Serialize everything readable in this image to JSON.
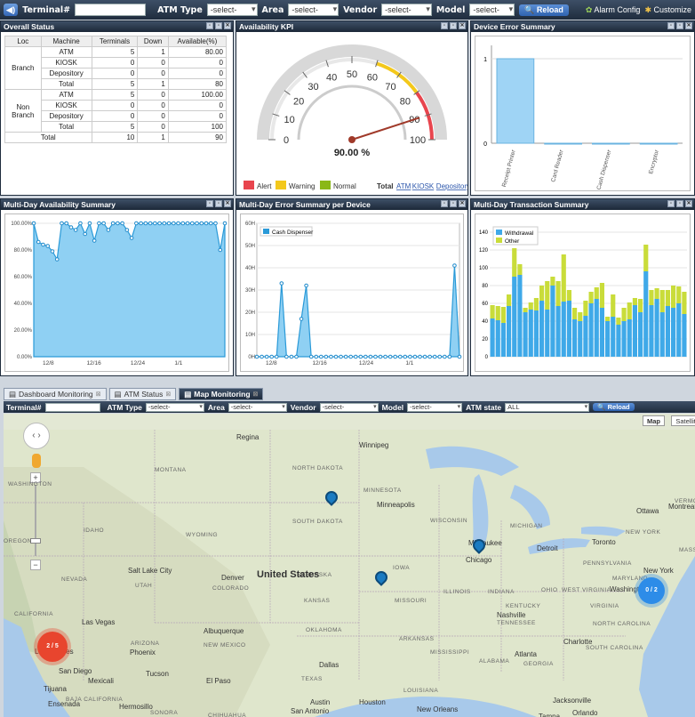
{
  "toolbar": {
    "terminal_label": "Terminal#",
    "atm_type_label": "ATM Type",
    "atm_type_value": "-select-",
    "area_label": "Area",
    "area_value": "-select-",
    "vendor_label": "Vendor",
    "vendor_value": "-select-",
    "model_label": "Model",
    "model_value": "-select-",
    "reload": "Reload",
    "alarm_config": "Alarm Config",
    "customize": "Customize"
  },
  "overall": {
    "title": "Overall Status",
    "headers": [
      "Loc",
      "Machine",
      "Terminals",
      "Down",
      "Available(%)"
    ],
    "rows": [
      [
        "Branch",
        "ATM",
        "5",
        "1",
        "80.00"
      ],
      [
        "",
        "KIOSK",
        "0",
        "0",
        "0"
      ],
      [
        "",
        "Depository",
        "0",
        "0",
        "0"
      ],
      [
        "",
        "Total",
        "5",
        "1",
        "80"
      ],
      [
        "Non\nBranch",
        "ATM",
        "5",
        "0",
        "100.00"
      ],
      [
        "",
        "KIOSK",
        "0",
        "0",
        "0"
      ],
      [
        "",
        "Depository",
        "0",
        "0",
        "0"
      ],
      [
        "",
        "Total",
        "5",
        "0",
        "100"
      ],
      [
        "Total",
        "",
        "10",
        "1",
        "90"
      ]
    ],
    "loc_branch": "Branch",
    "loc_non1": "Non",
    "loc_non2": "Branch"
  },
  "kpi": {
    "title": "Availability KPI",
    "value": "90.00 %",
    "ticks": [
      "0",
      "10",
      "20",
      "30",
      "40",
      "50",
      "60",
      "70",
      "80",
      "90",
      "100"
    ],
    "legend": [
      "Alert",
      "Warning",
      "Normal"
    ],
    "total_label": "Total",
    "links": [
      "ATM",
      "KIOSK",
      "Depository"
    ],
    "colors": {
      "alert": "#e8454e",
      "warning": "#f3c81b",
      "normal": "#8ab817"
    }
  },
  "device_error": {
    "title": "Device Error Summary"
  },
  "multi_avail": {
    "title": "Multi-Day Availability Summary"
  },
  "multi_err": {
    "title": "Multi-Day Error Summary per Device"
  },
  "multi_tx": {
    "title": "Multi-Day Transaction Summary"
  },
  "chart_data": [
    {
      "type": "bar",
      "title": "Device Error Summary",
      "categories": [
        "Receipt Printer",
        "Card Reader",
        "Cash Dispenser",
        "Encryptor"
      ],
      "values": [
        1,
        0,
        0,
        0
      ],
      "ylim": [
        0,
        1
      ]
    },
    {
      "type": "area",
      "title": "Multi-Day Availability Summary",
      "x_ticks": [
        "12/8",
        "12/16",
        "12/24",
        "1/1"
      ],
      "y_ticks": [
        "0.00%",
        "20.00%",
        "40.00%",
        "60.00%",
        "80.00%",
        "100.00%"
      ],
      "ylim": [
        0,
        100
      ],
      "values": [
        100,
        86,
        84,
        83,
        79,
        73,
        100,
        100,
        97,
        95,
        100,
        92,
        100,
        87,
        100,
        100,
        95,
        100,
        100,
        100,
        95,
        89,
        100,
        100,
        100,
        100,
        100,
        100,
        100,
        100,
        100,
        100,
        100,
        100,
        100,
        100,
        100,
        100,
        100,
        100,
        80,
        100
      ]
    },
    {
      "type": "area",
      "title": "Multi-Day Error Summary per Device",
      "series": [
        {
          "name": "Cash Dispenser",
          "values": [
            0,
            0,
            0,
            0,
            0,
            33,
            0,
            0,
            0,
            17,
            32,
            0,
            0,
            0,
            0,
            0,
            0,
            0,
            0,
            0,
            0,
            0,
            0,
            0,
            0,
            0,
            0,
            0,
            0,
            0,
            0,
            0,
            0,
            0,
            0,
            0,
            0,
            0,
            0,
            0,
            41,
            0
          ]
        }
      ],
      "x_ticks": [
        "12/8",
        "12/16",
        "12/24",
        "1/1"
      ],
      "y_ticks": [
        "0H",
        "10H",
        "20H",
        "30H",
        "40H",
        "50H",
        "60H"
      ],
      "ylim": [
        0,
        60
      ]
    },
    {
      "type": "bar",
      "title": "Multi-Day Transaction Summary",
      "stacked": true,
      "y_ticks": [
        "0",
        "20",
        "40",
        "60",
        "80",
        "100",
        "120",
        "140"
      ],
      "ylim": [
        0,
        150
      ],
      "series": [
        {
          "name": "Withdrawal",
          "color": "#3fa9e8",
          "values": [
            43,
            41,
            38,
            57,
            90,
            92,
            50,
            53,
            52,
            63,
            53,
            80,
            57,
            62,
            63,
            42,
            40,
            46,
            60,
            65,
            55,
            40,
            45,
            36,
            40,
            42,
            58,
            50,
            96,
            58,
            65,
            50,
            57,
            55,
            60,
            48
          ]
        },
        {
          "name": "Other",
          "color": "#c9dc3a",
          "values": [
            15,
            16,
            18,
            13,
            32,
            12,
            5,
            8,
            14,
            17,
            32,
            10,
            28,
            53,
            12,
            13,
            10,
            17,
            13,
            13,
            28,
            5,
            25,
            8,
            15,
            19,
            8,
            15,
            30,
            17,
            12,
            25,
            18,
            25,
            19,
            25
          ]
        }
      ]
    }
  ],
  "tabs": [
    "Dashboard Monitoring",
    "ATM Status",
    "Map Monitoring"
  ],
  "map_toolbar": {
    "terminal_label": "Terminal#",
    "atm_type_label": "ATM Type",
    "atm_type_value": "-select-",
    "area_label": "Area",
    "area_value": "-select-",
    "vendor_label": "Vendor",
    "vendor_value": "-select-",
    "model_label": "Model",
    "model_value": "-select-",
    "atm_state_label": "ATM state",
    "atm_state_value": "ALL",
    "reload": "Reload"
  },
  "map": {
    "map_btn": "Map",
    "satellite_btn": "Satellite",
    "country": "United States",
    "cluster_la": "2 / 5",
    "cluster_ny": "0 / 2",
    "states": [
      "MONTANA",
      "NORTH DAKOTA",
      "MINNESOTA",
      "SOUTH DAKOTA",
      "WISCONSIN",
      "MICHIGAN",
      "IDAHO",
      "WYOMING",
      "IOWA",
      "NEBRASKA",
      "NEVADA",
      "UTAH",
      "COLORADO",
      "KANSAS",
      "MISSOURI",
      "ILLINOIS",
      "INDIANA",
      "OHIO",
      "PENNSYLVANIA",
      "WEST VIRGINIA",
      "VIRGINIA",
      "MARYLAND",
      "KENTUCKY",
      "TENNESSEE",
      "NORTH CAROLINA",
      "SOUTH CAROLINA",
      "CALIFORNIA",
      "ARIZONA",
      "NEW MEXICO",
      "OKLAHOMA",
      "ARKANSAS",
      "MISSISSIPPI",
      "ALABAMA",
      "GEORGIA",
      "TEXAS",
      "LOUISIANA",
      "NEW YORK",
      "VERMONT",
      "MASS",
      "BAJA CALIFORNIA",
      "SONORA",
      "CHIHUAHUA",
      "WASHINGTON",
      "OREGON"
    ],
    "cities": [
      "Regina",
      "Winnipeg",
      "Minneapolis",
      "Ottawa",
      "Montreal",
      "Toronto",
      "Milwaukee",
      "Detroit",
      "Chicago",
      "Salt Lake City",
      "Denver",
      "Las Vegas",
      "Los Angeles",
      "San Diego",
      "Phoenix",
      "Tucson",
      "El Paso",
      "Albuquerque",
      "Dallas",
      "Austin",
      "Houston",
      "San Antonio",
      "New Orleans",
      "Nashville",
      "Atlanta",
      "Charlotte",
      "Washington",
      "New York",
      "Jacksonville",
      "Orlando",
      "Tampa",
      "Tijuana",
      "Mexicali",
      "Ensenada",
      "Hermosillo"
    ]
  }
}
